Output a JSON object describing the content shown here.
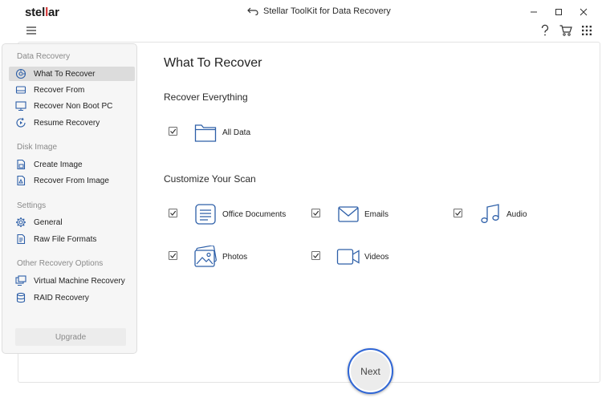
{
  "app": {
    "logo_text_a": "stel",
    "logo_text_b": "l",
    "logo_text_c": "ar",
    "window_title": "Stellar ToolKit for Data Recovery"
  },
  "toolbar": {
    "menu_icon": "hamburger-icon",
    "help_icon": "question-icon",
    "cart_icon": "cart-icon",
    "apps_icon": "grid-icon"
  },
  "sidebar": {
    "groups": [
      {
        "label": "Data Recovery"
      },
      {
        "label": "Disk Image"
      },
      {
        "label": "Settings"
      },
      {
        "label": "Other Recovery Options"
      }
    ],
    "items": [
      {
        "label": "What To Recover",
        "icon": "target-icon",
        "active": true
      },
      {
        "label": "Recover From",
        "icon": "drive-icon"
      },
      {
        "label": "Recover Non Boot PC",
        "icon": "monitor-icon"
      },
      {
        "label": "Resume Recovery",
        "icon": "resume-icon"
      },
      {
        "label": "Create Image",
        "icon": "create-image-icon"
      },
      {
        "label": "Recover From Image",
        "icon": "recover-image-icon"
      },
      {
        "label": "General",
        "icon": "gear-icon"
      },
      {
        "label": "Raw File Formats",
        "icon": "raw-file-icon"
      },
      {
        "label": "Virtual Machine Recovery",
        "icon": "virtual-machine-icon"
      },
      {
        "label": "RAID Recovery",
        "icon": "raid-icon"
      }
    ],
    "upgrade_label": "Upgrade"
  },
  "main": {
    "title": "What To Recover",
    "recover_everything": {
      "heading": "Recover Everything",
      "options": [
        {
          "label": "All Data",
          "checked": true,
          "icon": "folder-icon"
        }
      ]
    },
    "customize": {
      "heading": "Customize Your Scan",
      "options": [
        {
          "label": "Office Documents",
          "checked": true,
          "icon": "document-icon"
        },
        {
          "label": "Emails",
          "checked": true,
          "icon": "email-icon"
        },
        {
          "label": "Audio",
          "checked": true,
          "icon": "music-note-icon"
        },
        {
          "label": "Photos",
          "checked": true,
          "icon": "photo-icon"
        },
        {
          "label": "Videos",
          "checked": true,
          "icon": "video-icon"
        }
      ]
    },
    "next_label": "Next"
  },
  "colors": {
    "accent": "#2f66d6",
    "icon_blue": "#2d5fa8",
    "logo_red": "#d32f2f"
  }
}
